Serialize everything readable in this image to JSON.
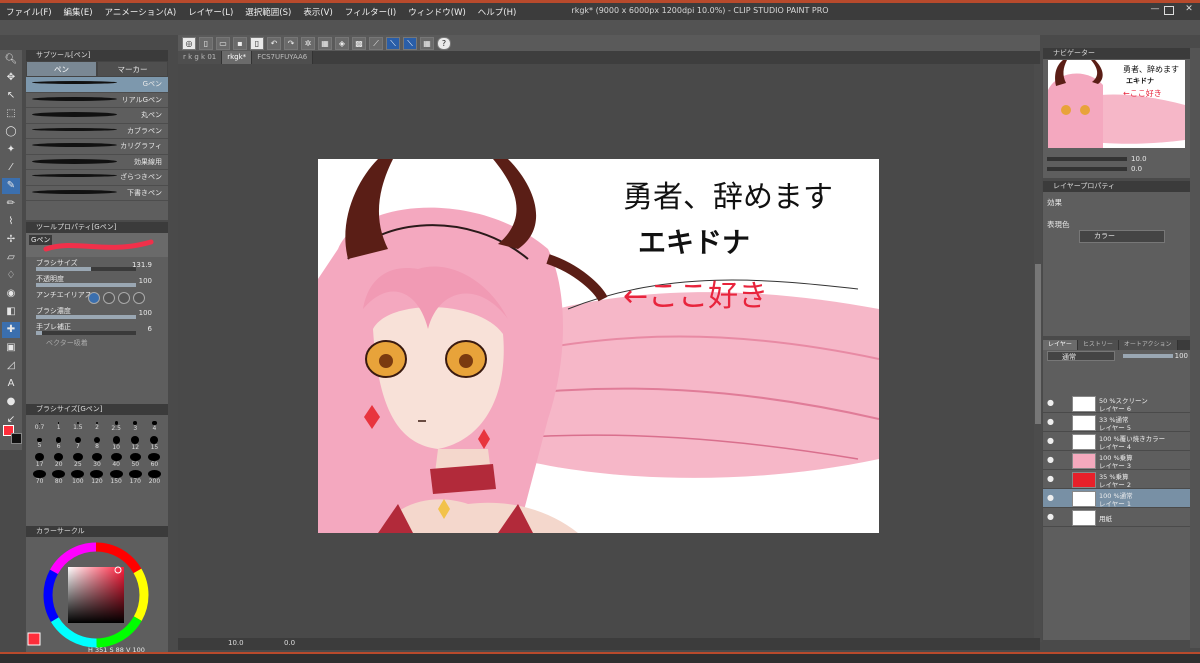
{
  "window": {
    "title": "rkgk* (9000 x 6000px 1200dpi 10.0%) - CLIP STUDIO PAINT PRO"
  },
  "menu": [
    "ファイル(F)",
    "編集(E)",
    "アニメーション(A)",
    "レイヤー(L)",
    "選択範囲(S)",
    "表示(V)",
    "フィルター(I)",
    "ウィンドウ(W)",
    "ヘルプ(H)"
  ],
  "tabs": [
    {
      "label": "r k g k 01",
      "active": false
    },
    {
      "label": "rkgk*",
      "active": true
    },
    {
      "label": "FCS7UFUYAA6",
      "active": false
    }
  ],
  "subtool_panel": {
    "title": "サブツール[ペン]",
    "tabs": [
      "ペン",
      "マーカー"
    ],
    "brushes": [
      "Gペン",
      "リアルGペン",
      "丸ペン",
      "カブラペン",
      "カリグラフィ",
      "効果線用",
      "ざらつきペン",
      "下書きペン"
    ],
    "selected_brush": 0
  },
  "tool_property": {
    "title": "ツールプロパティ[Gペン]",
    "brush_name": "Gペン",
    "brush_size_label": "ブラシサイズ",
    "brush_size_value": "131.9",
    "brush_size_level": 0.55,
    "opacity_label": "不透明度",
    "opacity_value": "100",
    "antialias_label": "アンチエイリアス",
    "density_label": "ブラシ濃度",
    "density_value": "100",
    "stabilization_label": "手ブレ補正",
    "stabilization_value": "6",
    "stabilization_level": 0.06,
    "vector_label": "ベクター吸着"
  },
  "brush_size_panel": {
    "title": "ブラシサイズ[Gペン]",
    "sizes": [
      "0.7",
      "1",
      "1.5",
      "2",
      "2.5",
      "3",
      "4",
      "5",
      "6",
      "7",
      "8",
      "10",
      "12",
      "15",
      "17",
      "20",
      "25",
      "30",
      "40",
      "50",
      "60",
      "70",
      "80",
      "100",
      "120",
      "150",
      "170",
      "200"
    ]
  },
  "color_panel": {
    "title": "カラーサークル",
    "h_value": "351",
    "s_value": "88",
    "v_value": "100",
    "main_color": "#ff2d3a"
  },
  "canvas": {
    "text_line1": "勇者、辞めます",
    "text_line2": "エキドナ",
    "text_line3": "←ここ好き",
    "text_line3_color": "#e8243c"
  },
  "status": {
    "zoom": "10.0",
    "angle": "0.0"
  },
  "navigator": {
    "title": "ナビゲーター",
    "zoom_value": "10.0",
    "angle_value": "0.0",
    "thumb_text1": "勇者、辞めます",
    "thumb_text2": "エキドナ",
    "thumb_text3": "←ここ好き"
  },
  "layer_property": {
    "title": "レイヤープロパティ",
    "effect_label": "効果",
    "expression_label": "表現色",
    "expression_value": "カラー"
  },
  "layer_panel": {
    "tabs": [
      "レイヤー",
      "ヒストリー",
      "オートアクション"
    ],
    "blend_mode": "通常",
    "opacity": "100",
    "layers": [
      {
        "mode": "50 %スクリーン",
        "name": "レイヤー 6",
        "selected": false,
        "thumb": "#ffffff"
      },
      {
        "mode": "33 %通常",
        "name": "レイヤー 5",
        "selected": false,
        "thumb": "#ffffff"
      },
      {
        "mode": "100 %覆い焼きカラー",
        "name": "レイヤー 4",
        "selected": false,
        "thumb": "#ffffff"
      },
      {
        "mode": "100 %乗算",
        "name": "レイヤー 3",
        "selected": false,
        "thumb": "#f4a9bd"
      },
      {
        "mode": "35 %乗算",
        "name": "レイヤー 2",
        "selected": false,
        "thumb": "#e8202a"
      },
      {
        "mode": "100 %通常",
        "name": "レイヤー 1",
        "selected": true,
        "thumb": "#ffffff"
      },
      {
        "mode": "",
        "name": "用紙",
        "selected": false,
        "thumb": "#ffffff"
      }
    ]
  }
}
